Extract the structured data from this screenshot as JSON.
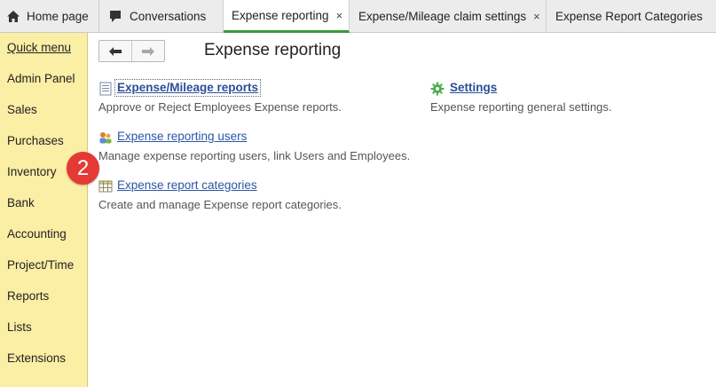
{
  "tabs": [
    {
      "label": "Home page",
      "icon": "home-icon",
      "active": false,
      "closable": false
    },
    {
      "label": "Conversations",
      "icon": "chat-icon",
      "active": false,
      "closable": false
    },
    {
      "label": "Expense reporting",
      "icon": null,
      "active": true,
      "closable": true
    },
    {
      "label": "Expense/Mileage claim settings",
      "icon": null,
      "active": false,
      "closable": true
    },
    {
      "label": "Expense Report Categories",
      "icon": null,
      "active": false,
      "closable": false
    }
  ],
  "close_glyph": "×",
  "sidebar": {
    "items": [
      {
        "label": "Quick menu"
      },
      {
        "label": "Admin Panel"
      },
      {
        "label": "Sales"
      },
      {
        "label": "Purchases"
      },
      {
        "label": "Inventory"
      },
      {
        "label": "Bank"
      },
      {
        "label": "Accounting"
      },
      {
        "label": "Project/Time"
      },
      {
        "label": "Reports"
      },
      {
        "label": "Lists"
      },
      {
        "label": "Extensions"
      }
    ]
  },
  "nav": {
    "back_icon": "arrow-left-icon",
    "forward_icon": "arrow-right-icon"
  },
  "main": {
    "title": "Expense reporting",
    "sections": [
      {
        "link": "Expense/Mileage reports",
        "description": "Approve or Reject Employees Expense reports.",
        "icon": "document-icon"
      },
      {
        "link": "Settings",
        "description": "Expense reporting general settings.",
        "icon": "gear-icon"
      },
      {
        "link": "Expense reporting users",
        "description": "Manage expense reporting users, link Users and Employees.",
        "icon": "users-icon"
      },
      {
        "link": "Expense report categories",
        "description": "Create and manage Expense report categories.",
        "icon": "table-icon"
      }
    ]
  },
  "badge": {
    "value": "2",
    "color": "#e53935"
  },
  "colors": {
    "sidebar_bg": "#fbeea5",
    "active_tab_accent": "#3a9b3a",
    "link": "#2b56a3"
  }
}
